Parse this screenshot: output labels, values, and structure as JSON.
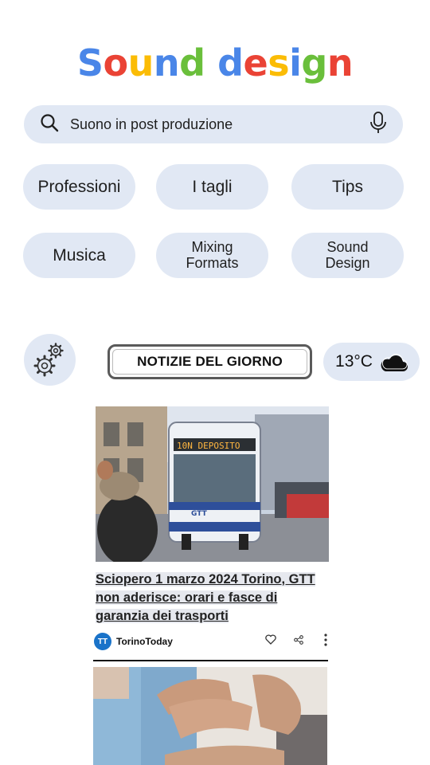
{
  "logo": {
    "letters": [
      {
        "ch": "S",
        "color": "#4a86e8"
      },
      {
        "ch": "o",
        "color": "#ea4335"
      },
      {
        "ch": "u",
        "color": "#fbbc05"
      },
      {
        "ch": "n",
        "color": "#4a86e8"
      },
      {
        "ch": "d",
        "color": "#6abf3b"
      },
      {
        "ch": " ",
        "color": "#000000"
      },
      {
        "ch": "d",
        "color": "#4a86e8"
      },
      {
        "ch": "e",
        "color": "#ea4335"
      },
      {
        "ch": "s",
        "color": "#fbbc05"
      },
      {
        "ch": "i",
        "color": "#4a86e8"
      },
      {
        "ch": "g",
        "color": "#6abf3b"
      },
      {
        "ch": "n",
        "color": "#ea4335"
      }
    ]
  },
  "search": {
    "query": "Suono in post produzione",
    "icon": "search-icon",
    "mic_icon": "microphone-icon"
  },
  "chips": [
    {
      "label": "Professioni"
    },
    {
      "label": "I tagli"
    },
    {
      "label": "Tips"
    },
    {
      "label": "Musica"
    },
    {
      "label": "Mixing\nFormats"
    },
    {
      "label": "Sound\nDesign"
    }
  ],
  "settings": {
    "icon": "gears-icon"
  },
  "news_header": {
    "label": "NOTIZIE DEL GIORNO"
  },
  "weather": {
    "temperature": "13°C",
    "icon": "cloud-icon"
  },
  "articles": [
    {
      "headline": "Sciopero 1 marzo 2024 Torino, GTT non aderisce: orari e fasce di garanzia dei trasporti",
      "source": "TorinoToday",
      "source_initials": "TT",
      "image": "bus-photo",
      "bus_sign": "10N DEPOSITO",
      "bus_brand": "GTT"
    },
    {
      "image": "physiotherapy-photo"
    }
  ],
  "colors": {
    "chip_bg": "#e1e8f4",
    "accent_blue": "#1a73c9"
  }
}
